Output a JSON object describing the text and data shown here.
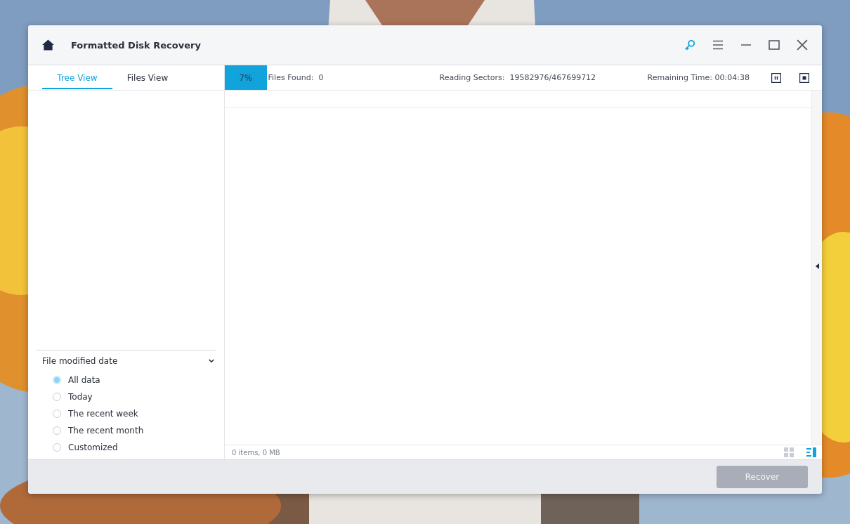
{
  "window": {
    "title": "Formatted Disk Recovery"
  },
  "tabs": [
    {
      "label": "Tree View",
      "selected": true
    },
    {
      "label": "Files View",
      "selected": false
    }
  ],
  "scan": {
    "level": 0.07,
    "percent": "7%",
    "files_found_label": "Files Found:",
    "files_found": "0",
    "sectors_label": "Reading Sectors:",
    "sectors": "19582976/467699712",
    "remaining_label": "Remaining Time:",
    "remaining": "00:04:38"
  },
  "filter": {
    "title": "File modified date",
    "expanded": true,
    "options": [
      {
        "label": "All data",
        "selected": true
      },
      {
        "label": "Today",
        "selected": false
      },
      {
        "label": "The recent week",
        "selected": false
      },
      {
        "label": "The recent month",
        "selected": false
      },
      {
        "label": "Customized",
        "selected": false
      }
    ]
  },
  "status": "0 items, 0 MB",
  "view_modes": [
    {
      "kind": "grid",
      "selected": false
    },
    {
      "kind": "list",
      "selected": true
    }
  ],
  "recover_button": {
    "label": "Recover",
    "disabled": true
  }
}
